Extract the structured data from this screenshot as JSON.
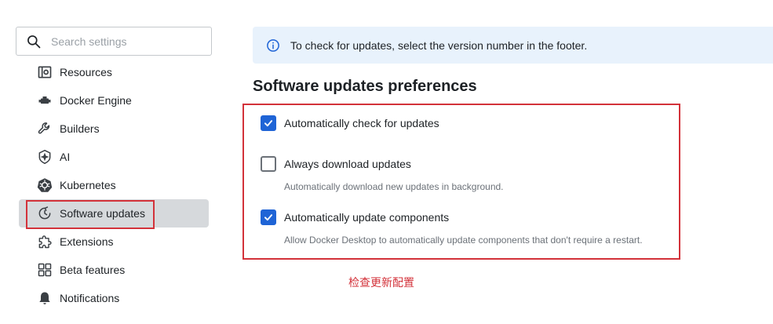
{
  "search": {
    "placeholder": "Search settings"
  },
  "sidebar": {
    "items": [
      {
        "label": "Resources",
        "icon": "resources-icon"
      },
      {
        "label": "Docker Engine",
        "icon": "docker-engine-icon"
      },
      {
        "label": "Builders",
        "icon": "wrench-icon"
      },
      {
        "label": "AI",
        "icon": "ai-icon"
      },
      {
        "label": "Kubernetes",
        "icon": "kubernetes-icon"
      },
      {
        "label": "Software updates",
        "icon": "clock-update-icon",
        "active": true
      },
      {
        "label": "Extensions",
        "icon": "puzzle-icon"
      },
      {
        "label": "Beta features",
        "icon": "grid-icon"
      },
      {
        "label": "Notifications",
        "icon": "bell-icon"
      }
    ]
  },
  "info": {
    "text": "To check for updates, select the version number in the footer."
  },
  "section": {
    "title": "Software updates preferences"
  },
  "options": [
    {
      "label": "Automatically check for updates",
      "checked": true,
      "description": ""
    },
    {
      "label": "Always download updates",
      "checked": false,
      "description": "Automatically download new updates in background."
    },
    {
      "label": "Automatically update components",
      "checked": true,
      "description": "Allow Docker Desktop to automatically update components that don't require a restart."
    }
  ],
  "annotation": {
    "text": "检查更新配置"
  },
  "colors": {
    "accent": "#1f64d6",
    "annotation": "#d3323a",
    "info_bg": "#e8f2fc",
    "active_bg": "#d6d9dc"
  }
}
